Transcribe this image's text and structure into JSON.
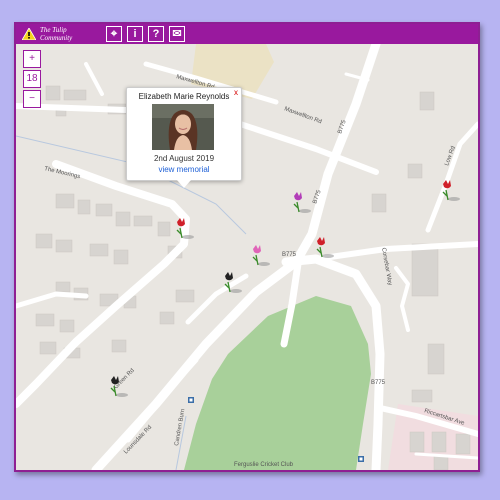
{
  "app": {
    "brand_line1": "The Tulip",
    "brand_line2": "Community"
  },
  "toolbar": [
    {
      "name": "locate-icon",
      "glyph": "⌖"
    },
    {
      "name": "info-icon",
      "glyph": "i"
    },
    {
      "name": "help-icon",
      "glyph": "?"
    },
    {
      "name": "message-icon",
      "glyph": "✉"
    }
  ],
  "zoom": {
    "plus": "+",
    "level": "18",
    "minus": "−"
  },
  "map_labels": {
    "maxwellton_1": "Maxwellton Rd",
    "maxwellton_2": "Maxwellton Rd",
    "moorings": "The Moorings",
    "green_rd": "Green Rd",
    "lounsdale": "Lounsdale Rd",
    "low_rd": "Low Rd",
    "corsebar_way": "Corsebar Way",
    "riccartsbar": "Riccartsbar Ave",
    "b775_a": "B775",
    "b775_b": "B775",
    "b775_c": "B775",
    "b775_d": "B775",
    "cricket": "Ferguslie Cricket Club",
    "burn": "Candren Burn"
  },
  "popup": {
    "name": "Elizabeth Marie Reynolds",
    "close": "x",
    "date": "2nd August 2019",
    "link": "view memorial"
  },
  "colors": {
    "frame": "#99199e",
    "background": "#b7b4f2",
    "map_base": "#e9e6e1",
    "road": "#ffffff",
    "park": "#a8d09a",
    "link": "#1d5fd6"
  }
}
